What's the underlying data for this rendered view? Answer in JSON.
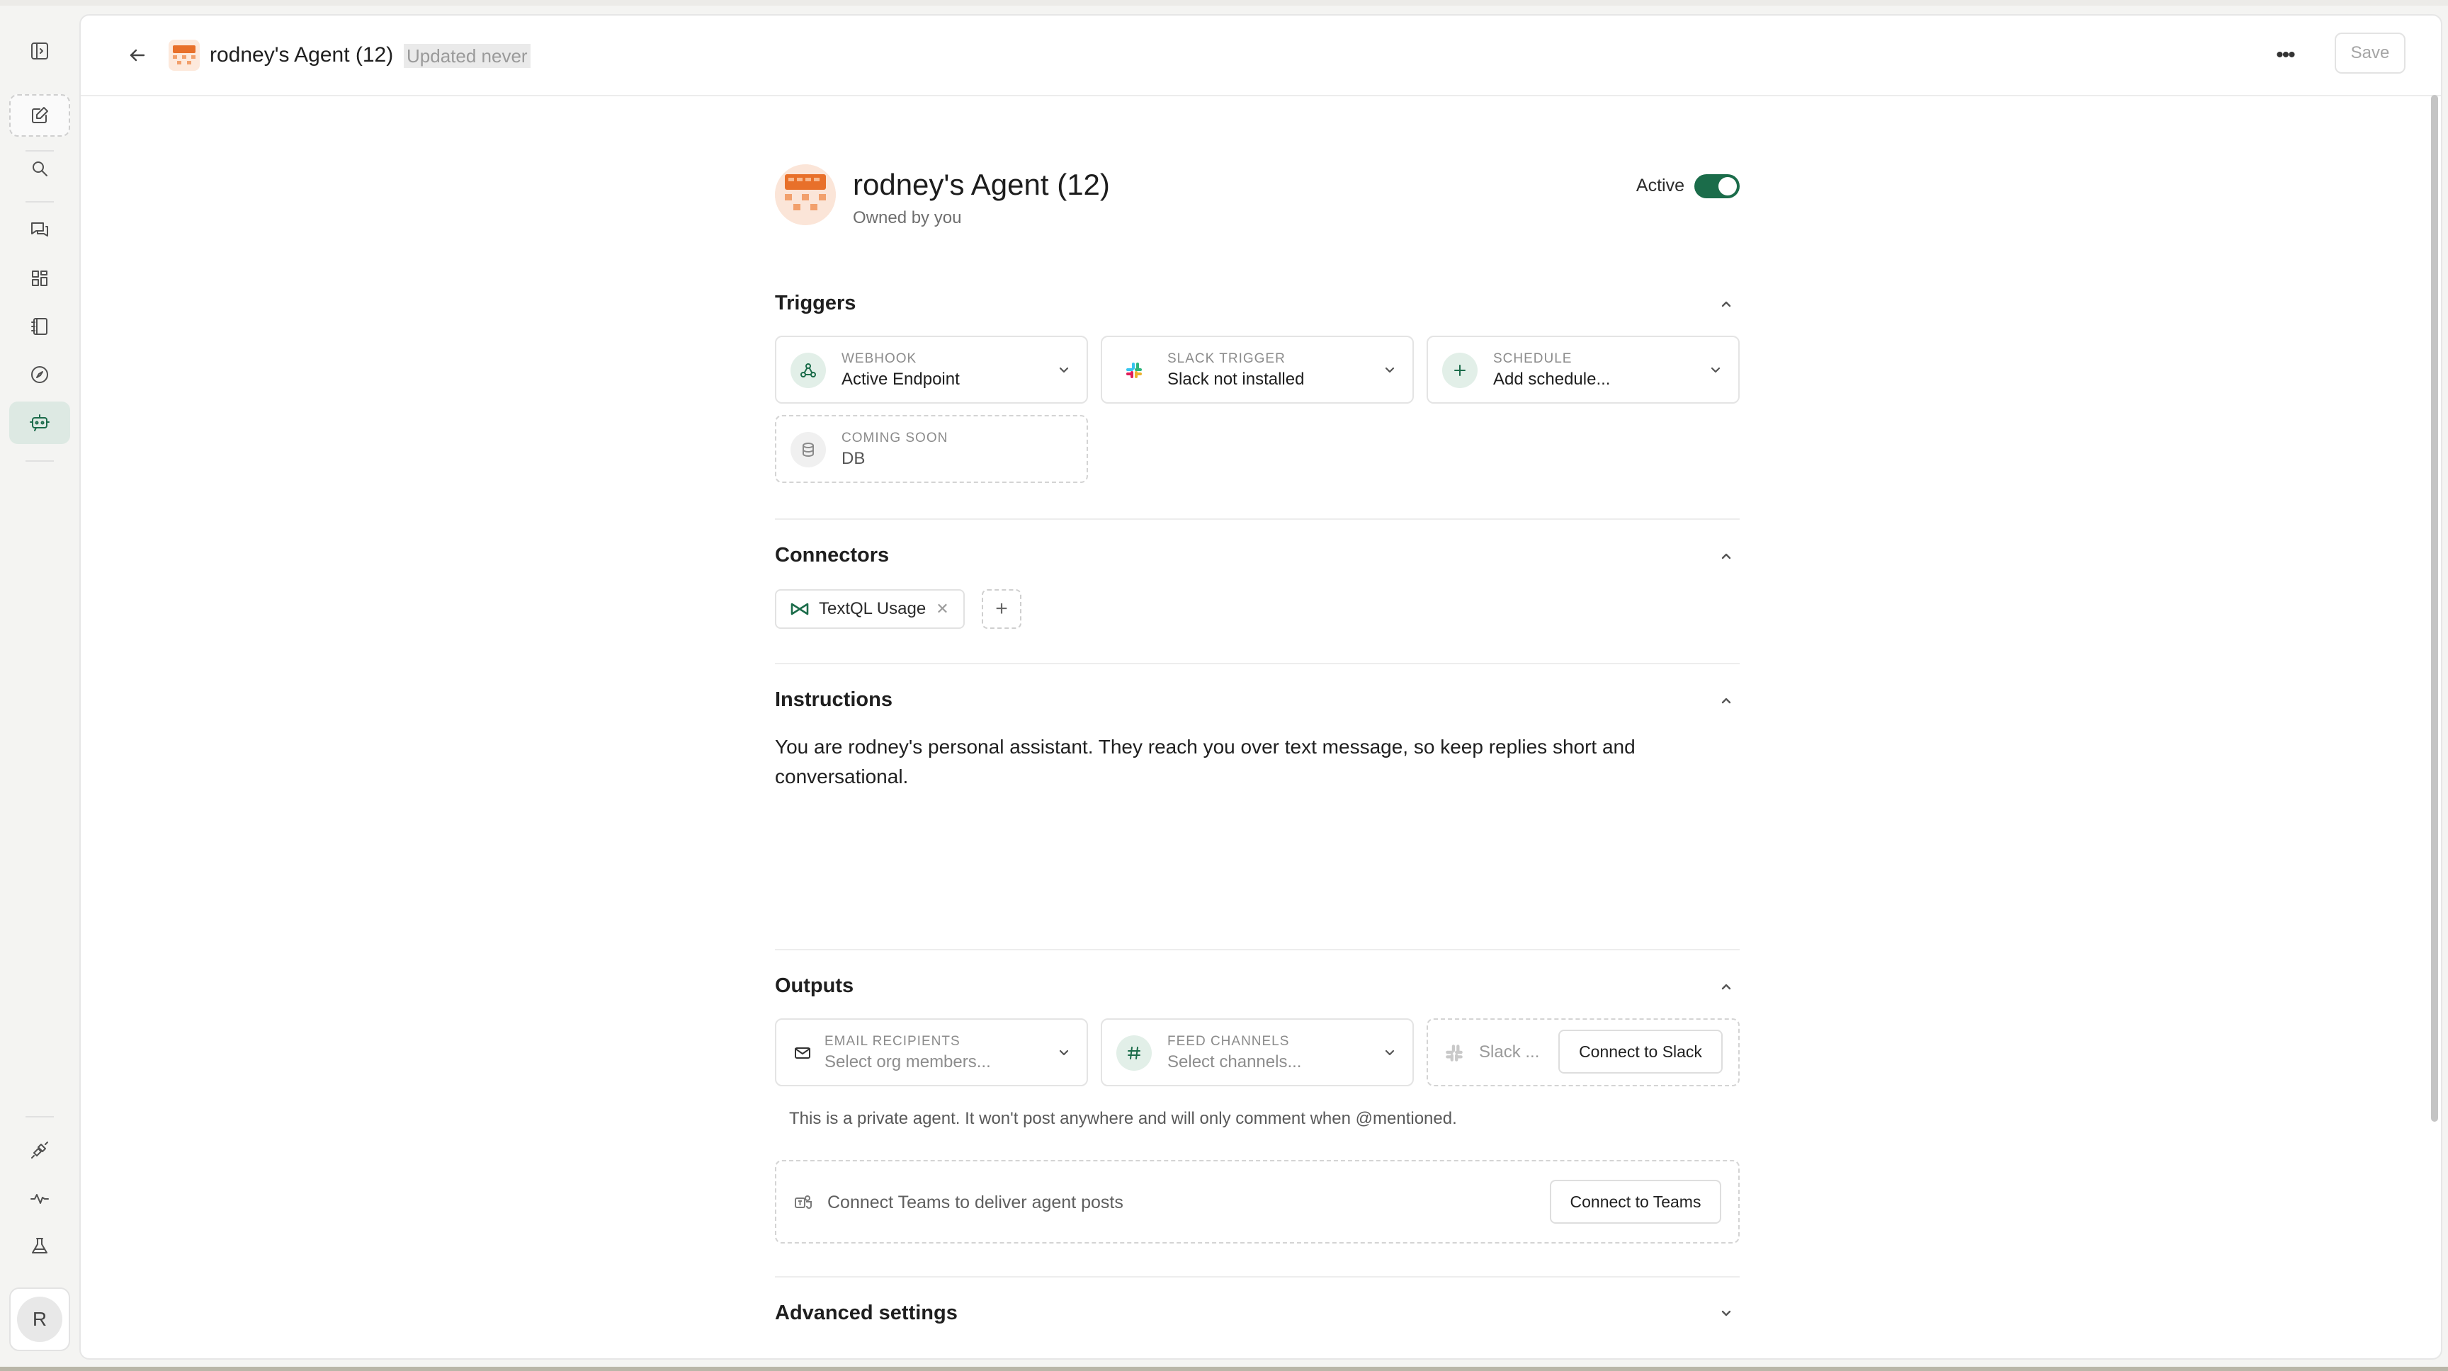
{
  "header": {
    "title": "rodney's Agent (12)",
    "updated": "Updated never",
    "save_label": "Save",
    "more_icon": "ellipsis-icon"
  },
  "rail": {
    "items": [
      "sidebar-toggle-icon",
      "new-chat-icon",
      "search-icon",
      "chats-icon",
      "dashboards-icon",
      "notebook-icon",
      "explore-icon",
      "agents-icon",
      "connectors-icon",
      "activity-icon",
      "lab-icon"
    ],
    "avatar_initial": "R"
  },
  "agent": {
    "name": "rodney's Agent (12)",
    "owner": "Owned by you",
    "active_label": "Active",
    "active": true
  },
  "triggers": {
    "title": "Triggers",
    "cards": [
      {
        "label": "WEBHOOK",
        "value": "Active Endpoint",
        "icon": "webhook-icon"
      },
      {
        "label": "SLACK TRIGGER",
        "value": "Slack not installed",
        "icon": "slack-icon"
      },
      {
        "label": "SCHEDULE",
        "value": "Add schedule...",
        "icon": "plus-icon"
      },
      {
        "label": "COMING SOON",
        "value": "DB",
        "icon": "database-icon"
      }
    ]
  },
  "connectors": {
    "title": "Connectors",
    "chips": [
      {
        "label": "TextQL Usage",
        "icon": "textql-logo-icon"
      }
    ],
    "add_label": "+"
  },
  "instructions": {
    "title": "Instructions",
    "text": "You are rodney's personal assistant. They reach you over text message, so keep replies short and conversational."
  },
  "outputs": {
    "title": "Outputs",
    "email": {
      "label": "EMAIL RECIPIENTS",
      "placeholder": "Select org members..."
    },
    "feed": {
      "label": "FEED CHANNELS",
      "placeholder": "Select channels..."
    },
    "slack": {
      "text": "Slack ...",
      "button": "Connect to Slack"
    },
    "private_note": "This is a private agent. It won't post anywhere and will only comment when @mentioned.",
    "teams": {
      "text": "Connect Teams to deliver agent posts",
      "button": "Connect to Teams"
    }
  },
  "advanced": {
    "title": "Advanced settings"
  },
  "colors": {
    "accent": "#1b6c4a",
    "logo_orange": "#e8702a",
    "logo_bg": "#fbe5d8"
  }
}
